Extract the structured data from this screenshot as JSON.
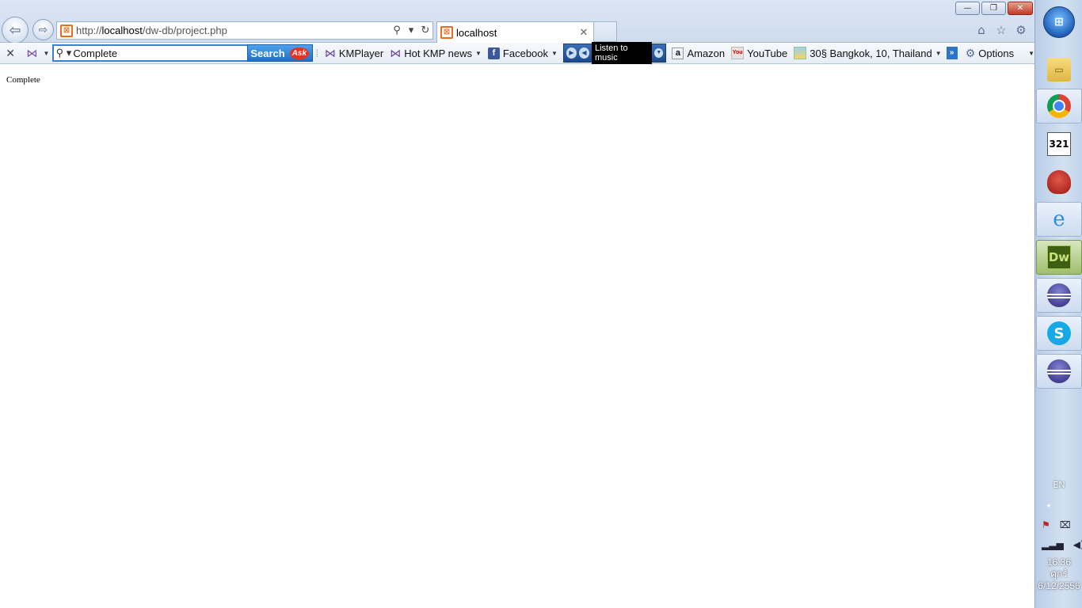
{
  "window": {
    "minimize_glyph": "—",
    "restore_glyph": "❐",
    "close_glyph": "✕"
  },
  "nav": {
    "back_glyph": "⇦",
    "forward_glyph": "⇨"
  },
  "address": {
    "url_prefix": "http://",
    "url_host": "localhost",
    "url_path": "/dw-db/project.php",
    "search_glyph": "⚲",
    "dropdown_glyph": "▾",
    "refresh_glyph": "↻",
    "site_icon": "xampp-icon"
  },
  "tab": {
    "label": "localhost",
    "close_glyph": "✕"
  },
  "right_icons": {
    "home": "⌂",
    "favorites": "☆",
    "tools": "⚙"
  },
  "toolbar": {
    "close_glyph": "✕",
    "search_value": "Complete",
    "search_button": "Search",
    "ask_logo": "Ask",
    "items": {
      "kmplayer": "KMPlayer",
      "hot_kmp_news": "Hot KMP news",
      "facebook": "Facebook",
      "listen_to_music": "Listen to music",
      "amazon": "Amazon",
      "youtube": "YouTube",
      "weather": "30§ Bangkok, 10, Thailand",
      "options": "Options"
    },
    "more_glyph": "»"
  },
  "page": {
    "text": "Complete"
  },
  "taskbar": {
    "apps": [
      "folder-icon",
      "chrome-icon",
      "media-player-classic-icon",
      "red-user-icon",
      "internet-explorer-icon",
      "dreamweaver-icon",
      "eclipse-icon",
      "skype-icon",
      "eclipse-icon"
    ],
    "dw_label": "Dw",
    "mpc_label": "321",
    "ie_glyph": "e",
    "skype_glyph": "S",
    "language": "EN",
    "show_hidden_glyph": "◂",
    "time": "16:36",
    "day": "ศุกร์",
    "date": "6/12/2556"
  },
  "colors": {
    "accent": "#3f7fd1",
    "search_button": "#1f6fc7",
    "facebook": "#3b5998",
    "taskbar": "#c2d4ea"
  }
}
